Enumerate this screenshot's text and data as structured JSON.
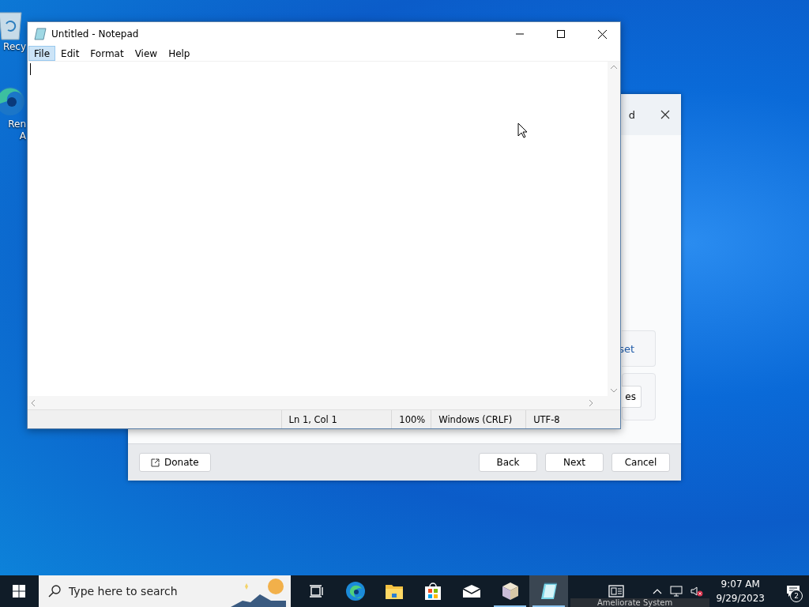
{
  "desktop_icons": [
    {
      "kind": "recycle-bin",
      "lines": [
        "Recy"
      ]
    },
    {
      "kind": "edge",
      "lines": [
        "Ren",
        "A"
      ]
    }
  ],
  "background_dialog": {
    "title": "d",
    "partial_buttons": [
      "set",
      "es"
    ],
    "donate": "Donate",
    "buttons": [
      "Back",
      "Next",
      "Cancel"
    ]
  },
  "notepad": {
    "title": "Untitled - Notepad",
    "menu": [
      {
        "label": "File",
        "selected": true
      },
      {
        "label": "Edit",
        "selected": false
      },
      {
        "label": "Format",
        "selected": false
      },
      {
        "label": "View",
        "selected": false
      },
      {
        "label": "Help",
        "selected": false
      }
    ],
    "status_bar": [
      "Ln 1, Col 1",
      "100%",
      "Windows (CRLF)",
      "UTF-8"
    ]
  },
  "taskbar": {
    "search": {
      "placeholder": "Type here to search"
    },
    "apps": [
      {
        "kind": "task-view",
        "running": false,
        "active": false
      },
      {
        "kind": "edge",
        "running": false,
        "active": false
      },
      {
        "kind": "explorer",
        "running": false,
        "active": false
      },
      {
        "kind": "store",
        "running": false,
        "active": false
      },
      {
        "kind": "mail",
        "running": false,
        "active": false
      },
      {
        "kind": "package",
        "running": true,
        "active": false
      },
      {
        "kind": "notepad",
        "running": true,
        "active": true
      }
    ],
    "clock": {
      "time": "9:07 AM",
      "date": "9/29/2023"
    },
    "notification_count": "2"
  },
  "popup": {
    "text": "Ameliorate System"
  }
}
